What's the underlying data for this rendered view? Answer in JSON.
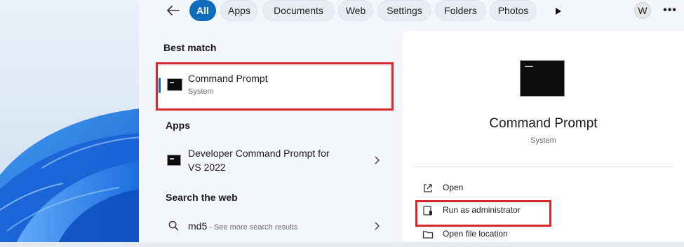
{
  "filters": {
    "back_icon": "arrow-left-icon",
    "items": [
      "All",
      "Apps",
      "Documents",
      "Web",
      "Settings",
      "Folders",
      "Photos"
    ],
    "active": "All",
    "play_icon": "play-icon",
    "avatar_initial": "W",
    "more_icon": "ellipsis-icon"
  },
  "best_match": {
    "heading": "Best match",
    "title": "Command Prompt",
    "subtitle": "System",
    "icon": "command-prompt-icon"
  },
  "apps": {
    "heading": "Apps",
    "items": [
      {
        "title_line1": "Developer Command Prompt for",
        "title_line2": "VS 2022",
        "icon": "command-prompt-icon"
      }
    ]
  },
  "web": {
    "heading": "Search the web",
    "query": "md5",
    "hint": " - See more search results",
    "icon": "search-icon"
  },
  "details": {
    "title": "Command Prompt",
    "subtitle": "System",
    "actions": [
      {
        "label": "Open",
        "icon": "open-external-icon"
      },
      {
        "label": "Run as administrator",
        "icon": "shield-icon"
      },
      {
        "label": "Open file location",
        "icon": "folder-icon"
      }
    ]
  },
  "colors": {
    "accent": "#0f6cbd",
    "highlight": "#d42a2f"
  }
}
